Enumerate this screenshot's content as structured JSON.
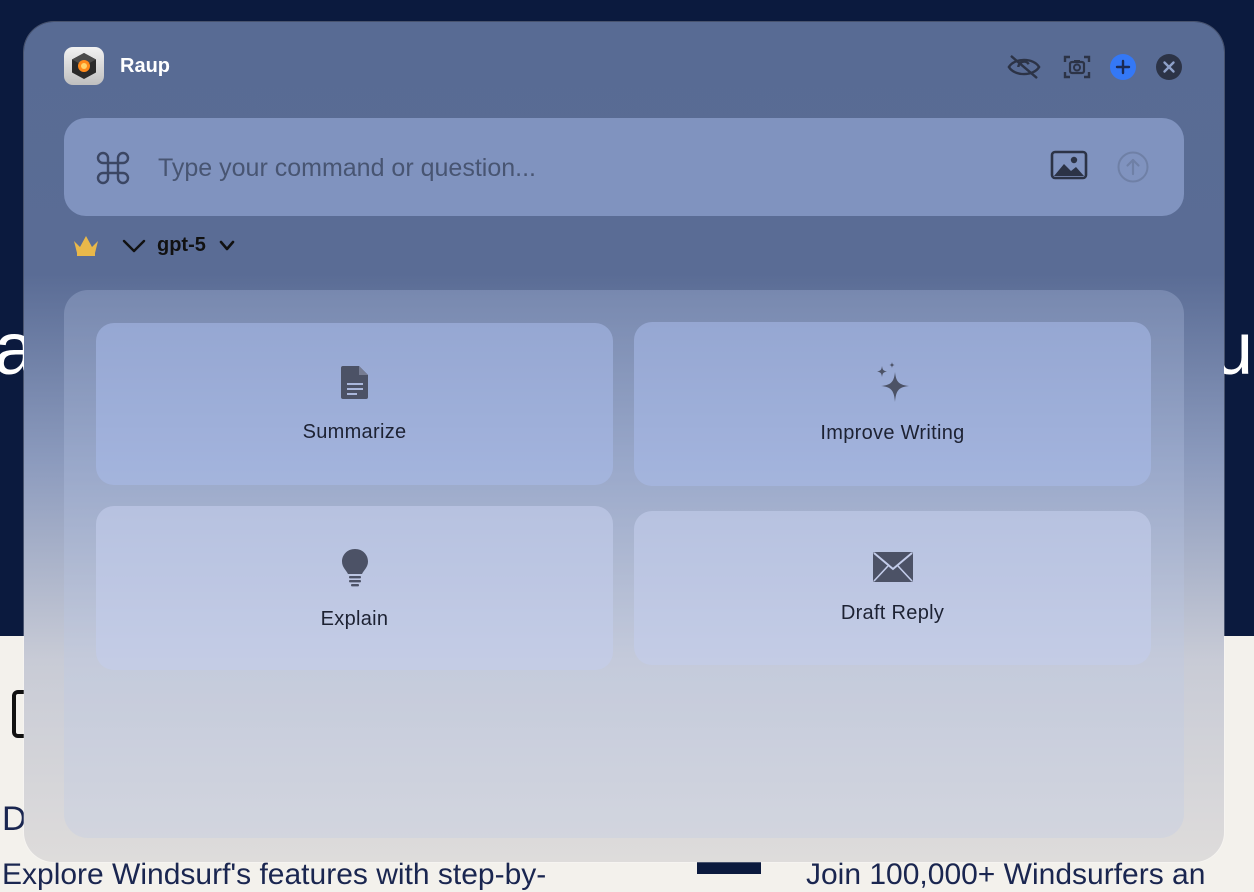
{
  "background": {
    "hero_left": "a",
    "hero_right": "ur",
    "letter": "D",
    "text_left": "Explore Windsurf's features with step-by-",
    "text_right": "Join 100,000+ Windsurfers an"
  },
  "window": {
    "app_name": "Raup",
    "controls": [
      {
        "name": "hide",
        "icon": "eye-slash-icon"
      },
      {
        "name": "screenshot",
        "icon": "camera-icon"
      },
      {
        "name": "new",
        "icon": "plus-icon"
      },
      {
        "name": "close",
        "icon": "close-icon"
      }
    ]
  },
  "input": {
    "placeholder": "Type your command or question...",
    "value": ""
  },
  "model": {
    "name": "gpt-5",
    "crown_color": "#e9b84a"
  },
  "actions": [
    {
      "label": "Summarize",
      "icon": "document-icon"
    },
    {
      "label": "Improve Writing",
      "icon": "sparkles-icon"
    },
    {
      "label": "Explain",
      "icon": "lightbulb-icon"
    },
    {
      "label": "Draft Reply",
      "icon": "envelope-icon"
    }
  ],
  "colors": {
    "accent": "#3478f6",
    "background_dark": "#0b1a3e"
  }
}
